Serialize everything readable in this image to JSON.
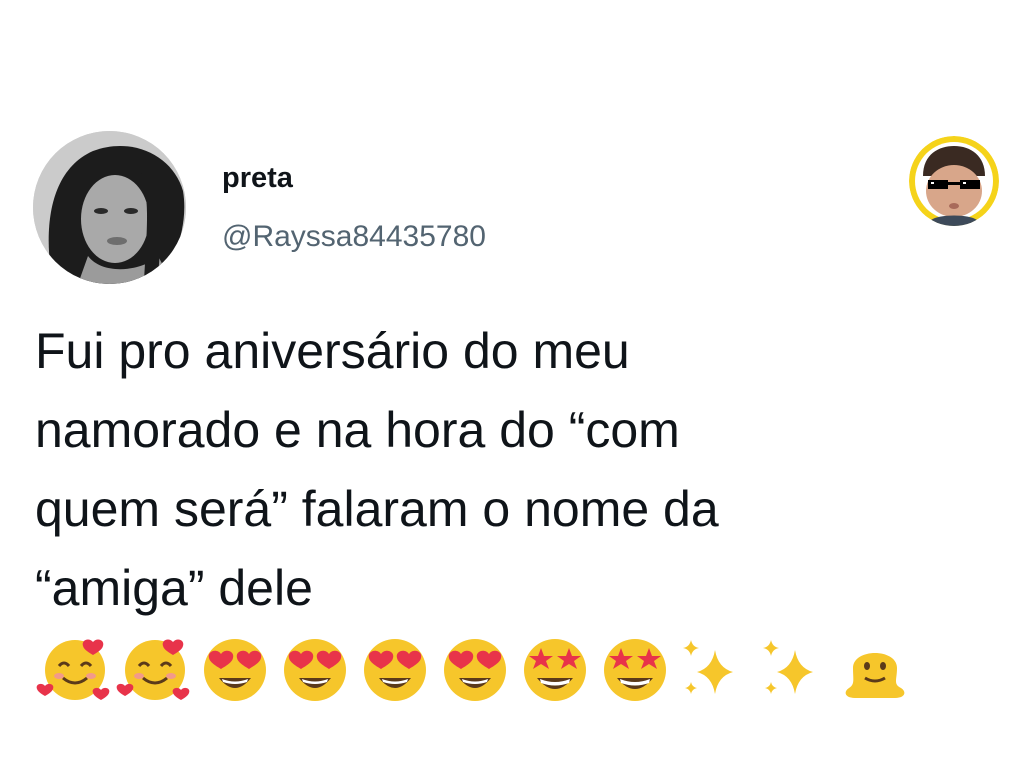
{
  "tweet": {
    "display_name": "preta",
    "handle": "@Rayssa84435780",
    "text": "Fui pro aniversário do meu\nnamorado e na hora do “com\nquem será” falaram o nome da\n“amiga” dele",
    "emojis": [
      "smiling-face-with-hearts-icon",
      "smiling-face-with-hearts-icon",
      "heart-eyes-icon",
      "heart-eyes-icon",
      "heart-eyes-icon",
      "heart-eyes-icon",
      "star-struck-icon",
      "star-struck-icon",
      "sparkles-icon",
      "sparkles-icon",
      "melting-face-icon"
    ]
  },
  "colors": {
    "text": "#0f1419",
    "handle": "#536471",
    "emoji_yellow": "#f6c62b",
    "heart_red": "#e8334a",
    "corner_ring": "#f5d31a"
  }
}
